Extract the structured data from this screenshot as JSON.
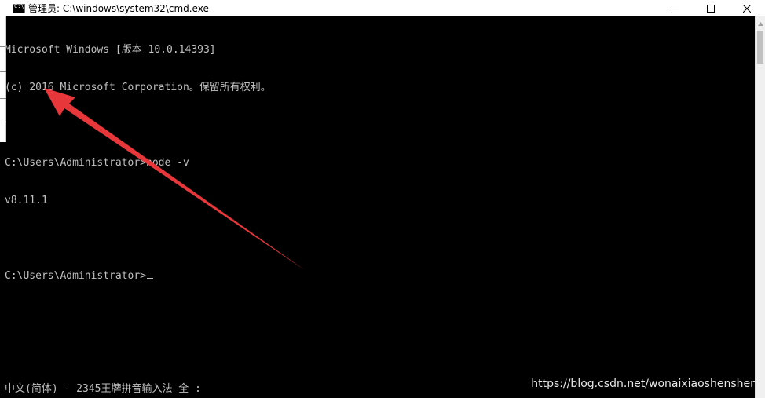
{
  "window": {
    "title": "管理员: C:\\windows\\system32\\cmd.exe",
    "icons": {
      "app": "cmd-icon",
      "minimize": "minimize-icon",
      "maximize": "maximize-icon",
      "close": "close-icon"
    }
  },
  "console": {
    "lines": [
      "Microsoft Windows [版本 10.0.14393]",
      "(c) 2016 Microsoft Corporation。保留所有权利。",
      "",
      "C:\\Users\\Administrator>node -v",
      "v8.11.1",
      "",
      "C:\\Users\\Administrator>"
    ],
    "text_color": "#c0c0c0",
    "background_color": "#000000"
  },
  "ime_status": "中文(简体) - 2345王牌拼音输入法 全 :",
  "watermark": "https://blog.csdn.net/wonaixiaoshenshen",
  "annotation": {
    "color": "#e8373a",
    "icon": "red-arrow-annotation"
  }
}
